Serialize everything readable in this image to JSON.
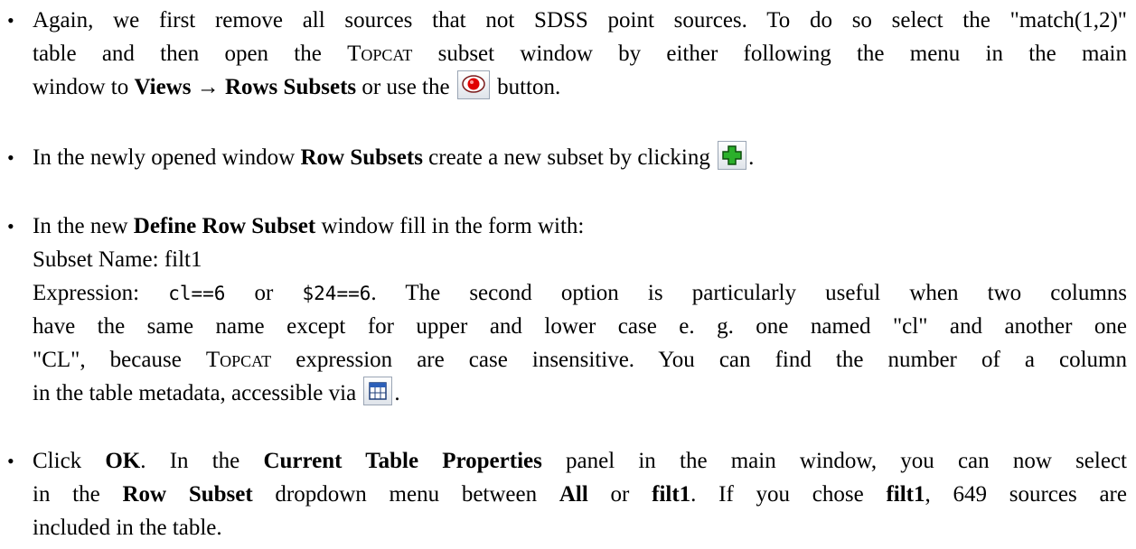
{
  "bullet": "•",
  "items": [
    {
      "lines": [
        {
          "a": "Again, we first remove all sources that not SDSS point sources. To do so select the \"match(1,2)\""
        },
        {
          "a": "table and then open the ",
          "topcat": "Topcat",
          "b": " subset window by either following the menu in the main"
        },
        {
          "a": "window to ",
          "views": "Views",
          "arrow": "→",
          "rows_subsets": "Rows Subsets",
          "b": " or use the ",
          "c": " button."
        }
      ]
    },
    {
      "lines": [
        {
          "a": "In the newly opened window ",
          "row_subsets": "Row Subsets",
          "b": " create a new subset by clicking ",
          "c": "."
        }
      ]
    },
    {
      "lines": [
        {
          "a": "In the new ",
          "define_row_subset": "Define Row Subset",
          "b": " window fill in the form with:"
        },
        {
          "a": "Subset Name: filt1"
        },
        {
          "a": "Expression: ",
          "code1": "cl==6",
          "b": " or ",
          "code2": "$24==6",
          "c": ". The second option is particularly useful when two columns"
        },
        {
          "a": "have the same name except for upper and lower case e. g.  one named \"cl\" and another one"
        },
        {
          "a": "\"CL\", because ",
          "topcat": "Topcat",
          "b": " expression are case insensitive. You can find the number of a column"
        },
        {
          "a": "in the table metadata, accessible via ",
          "c": "."
        }
      ]
    },
    {
      "lines": [
        {
          "a": "Click ",
          "ok": "OK",
          "b": ". In the ",
          "current_table_properties": "Current Table Properties",
          "c": " panel in the main window, you can now select"
        },
        {
          "a": "in the ",
          "row_subset": "Row Subset",
          "b": " dropdown menu between ",
          "all": "All",
          "c": " or ",
          "filt1": "filt1",
          "d": ".  If you chose ",
          "filt1b": "filt1",
          "e": ", 649 sources are"
        },
        {
          "a": "included in the table."
        }
      ]
    }
  ],
  "icons": {
    "subsets_button": "subsets-eye-icon",
    "add_button": "green-plus-icon",
    "metadata_button": "table-metadata-icon"
  },
  "colors": {
    "eye_red": "#e00000",
    "plus_green": "#2bb02b"
  }
}
